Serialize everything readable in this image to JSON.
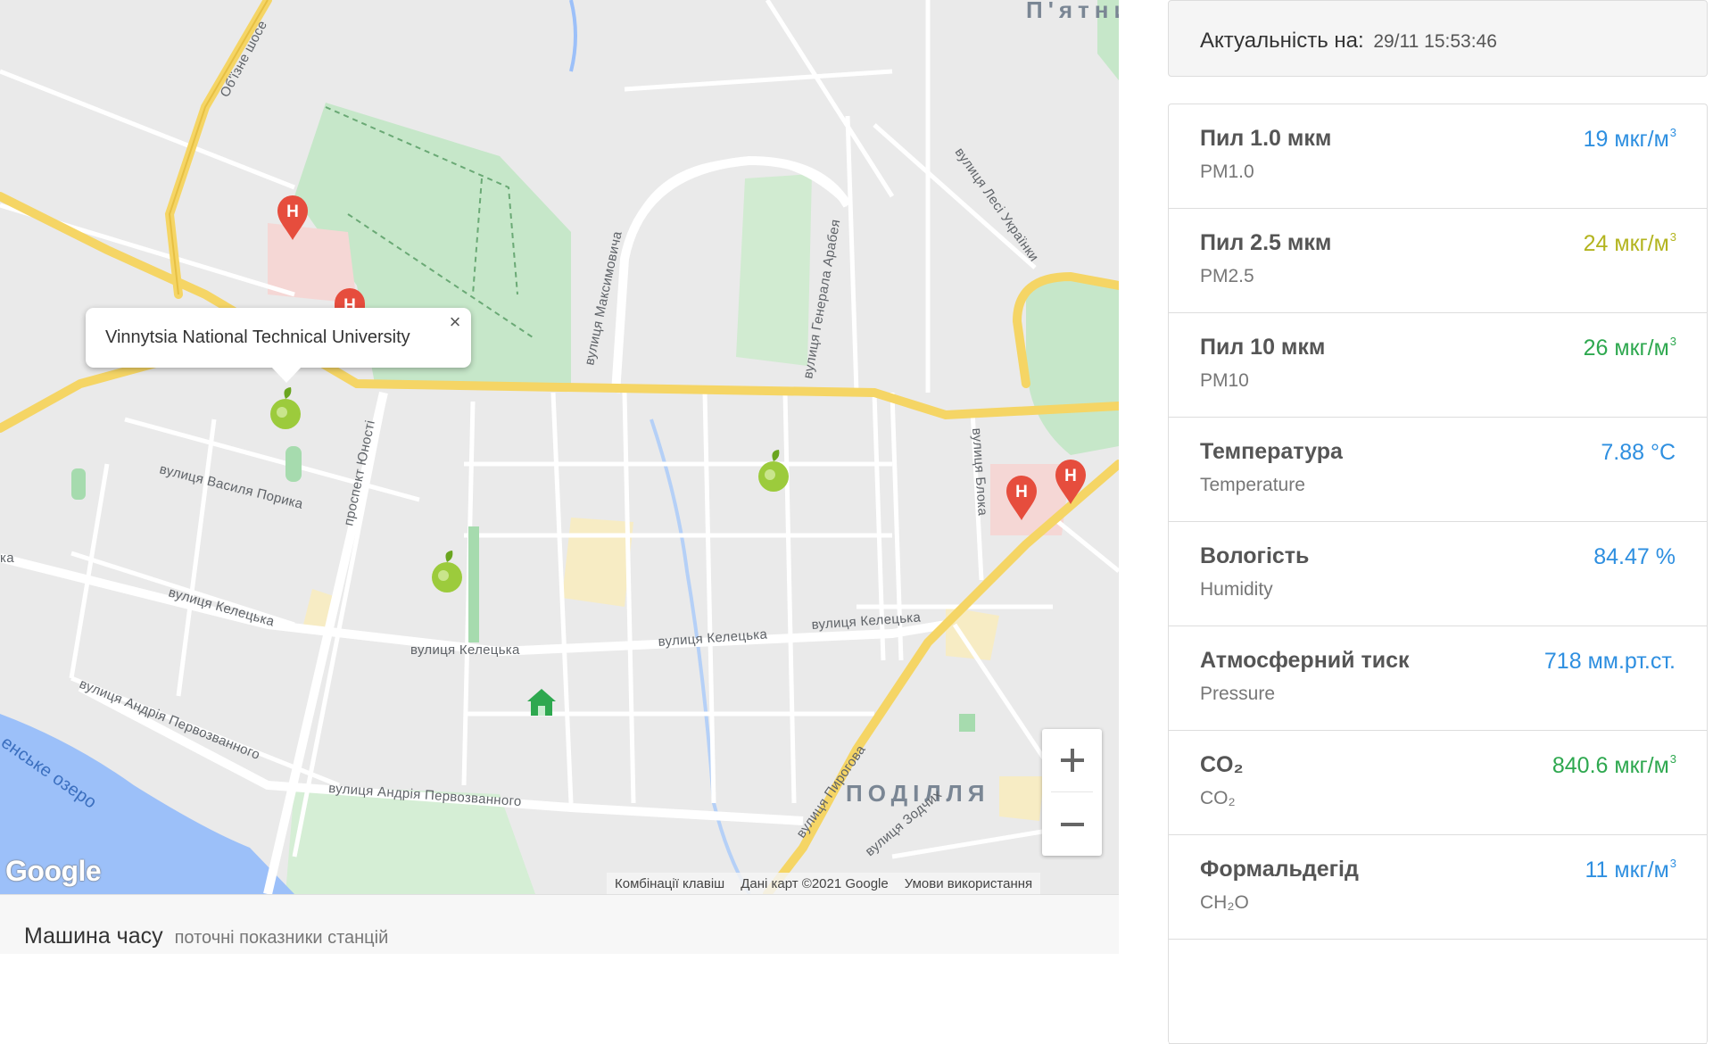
{
  "map": {
    "popup_title": "Vinnytsia National Technical University",
    "popup_close": "×",
    "zoom_in": "+",
    "zoom_out": "−",
    "logo": "Google",
    "attribution": {
      "shortcuts": "Комбінації клавіш",
      "data": "Дані карт ©2021 Google",
      "terms": "Умови використання"
    },
    "labels": {
      "obizne": "Об'їзне шосе",
      "pyatnychany": "П'ятни",
      "lesi": "вулиця Лесі Українки",
      "maksymovycha": "вулиця Максимовича",
      "arabeia": "вулиця Генерала Арабея",
      "bloka": "вулиця Блока",
      "poryka": "вулиця Василя Порика",
      "yunosti": "проспект Юності",
      "keletska1": "вулиця Келецька",
      "keletska2": "вулиця Келецька",
      "keletska3": "вулиця Келецька",
      "keletska4": "вулиця Келецька",
      "ka": "ка",
      "pervozvannoho1": "вулиця Андрія Первозванного",
      "pervozvannoho2": "вулиця Андрія Первозванного",
      "pyrohova": "вулиця Пирогова",
      "podillia": "ПОДІЛЛЯ",
      "ozero": "енське озеро",
      "zodchykh": "вулиця Зодчих"
    },
    "icons": {
      "hospital": "hospital-marker-icon",
      "station": "station-leaf-marker-icon",
      "home": "home-marker-icon"
    },
    "colors": {
      "road_major": "#f5d565",
      "park": "#a6dbae",
      "water": "#8ab4f8",
      "hospital": "#e64d3d",
      "station": "#9ccb3c"
    }
  },
  "footer": {
    "title": "Машина часу",
    "subtitle": "поточні показники станцій"
  },
  "panel": {
    "timestamp_label": "Актуальність на:",
    "timestamp_value": "29/11 15:53:46",
    "metrics": [
      {
        "name": "Пил 1.0 мкм",
        "code": "PM1.0",
        "value": "19 мкг/м",
        "sup": "3",
        "color": "blue"
      },
      {
        "name": "Пил 2.5 мкм",
        "code": "PM2.5",
        "value": "24 мкг/м",
        "sup": "3",
        "color": "yellow"
      },
      {
        "name": "Пил 10 мкм",
        "code": "PM10",
        "value": "26 мкг/м",
        "sup": "3",
        "color": "green"
      },
      {
        "name": "Температура",
        "code": "Temperature",
        "value": "7.88 °C",
        "sup": "",
        "color": "blue"
      },
      {
        "name": "Вологість",
        "code": "Humidity",
        "value": "84.47 %",
        "sup": "",
        "color": "blue"
      },
      {
        "name": "Атмосферний тиск",
        "code": "Pressure",
        "value": "718 мм.рт.ст.",
        "sup": "",
        "color": "blue"
      },
      {
        "name": "CO₂",
        "code": "CO₂",
        "value": "840.6 мкг/м",
        "sup": "3",
        "color": "green"
      },
      {
        "name": "Формальдегід",
        "code": "CH₂O",
        "value": "11 мкг/м",
        "sup": "3",
        "color": "blue"
      }
    ],
    "status_colors": {
      "blue": "#2e8fe0",
      "yellow": "#b3b41f",
      "green": "#2ea84f"
    }
  }
}
